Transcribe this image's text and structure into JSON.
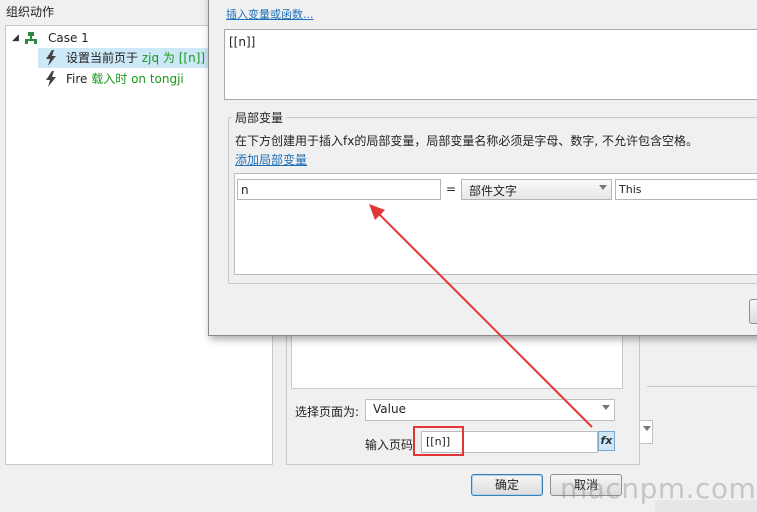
{
  "left_panel": {
    "title": "组织动作",
    "case_label": "Case 1",
    "action1_prefix": "设置当前页于",
    "action1_detail": "zjq 为 [[n]]",
    "action2_prefix": "Fire",
    "action2_detail": "载入时 on tongji"
  },
  "front_dialog": {
    "insert_link": "插入变量或函数...",
    "expression": "[[n]]",
    "locals_title": "局部变量",
    "locals_desc": "在下方创建用于插入fx的局部变量，局部变量名称必须是字母、数字, 不允许包含空格。",
    "add_local_link": "添加局部变量",
    "local_var": {
      "name": "n",
      "equals": "=",
      "type": "部件文字",
      "target": "This"
    }
  },
  "page_action": {
    "select_label": "选择页面为:",
    "select_value": "Value",
    "page_num_label": "输入页码",
    "page_num_value": "[[n]]",
    "fx_label": "fx",
    "ok_label": "确定",
    "cancel_label": "取消"
  },
  "watermark": "macnpm.com",
  "colors": {
    "highlight": "#cde8f6",
    "annotation_red": "#e23535",
    "link_blue": "#1d6fb8",
    "action_green": "#1a9a1a"
  }
}
